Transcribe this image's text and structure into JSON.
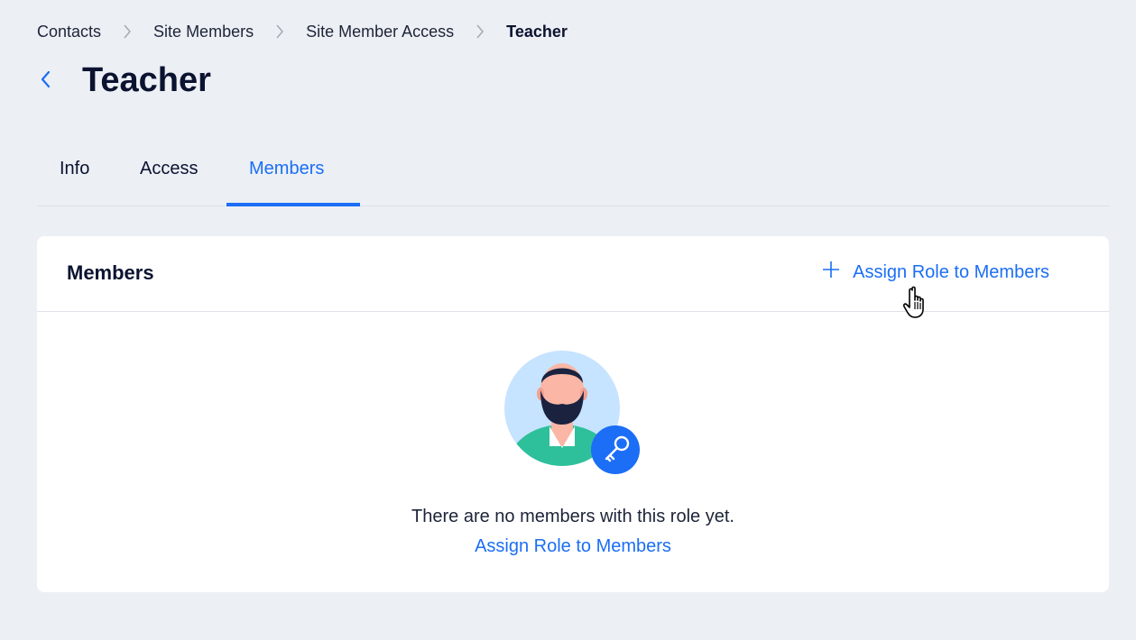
{
  "breadcrumb": {
    "items": [
      "Contacts",
      "Site Members",
      "Site Member Access"
    ],
    "current": "Teacher"
  },
  "header": {
    "title": "Teacher",
    "back_icon": "chevron-left-icon"
  },
  "tabs": [
    {
      "label": "Info",
      "active": false
    },
    {
      "label": "Access",
      "active": false
    },
    {
      "label": "Members",
      "active": true
    }
  ],
  "members_card": {
    "title": "Members",
    "assign_button_label": "Assign Role to Members",
    "assign_button_icon": "plus-icon",
    "empty_state": {
      "illustration": "member-avatar-with-key-illustration",
      "message": "There are no members with this role yet.",
      "link_label": "Assign Role to Members"
    }
  },
  "colors": {
    "accent": "#1b6ef5",
    "page_background": "#eceff4",
    "text_primary": "#0b1330"
  }
}
